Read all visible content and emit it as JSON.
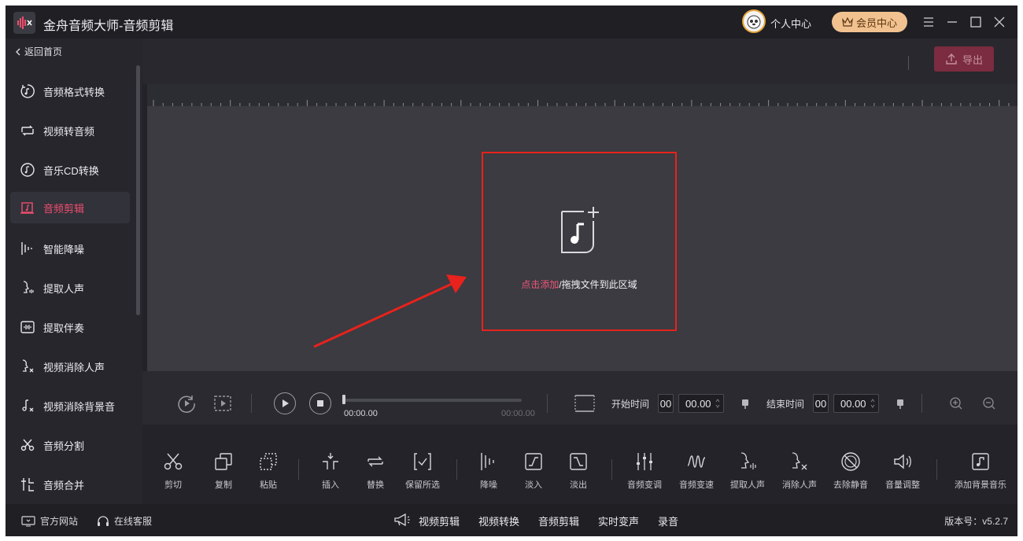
{
  "title_bar": {
    "app_title": "金舟音频大师-音频剪辑",
    "personal_center": "个人中心",
    "vip_center": "会员中心"
  },
  "sidebar": {
    "back_label": "返回首页",
    "items": [
      {
        "label": "音频格式转换",
        "icon": "audio-convert-icon"
      },
      {
        "label": "视频转音频",
        "icon": "video-to-audio-icon"
      },
      {
        "label": "音乐CD转换",
        "icon": "cd-icon"
      },
      {
        "label": "音频剪辑",
        "icon": "audio-edit-icon",
        "active": true
      },
      {
        "label": "智能降噪",
        "icon": "denoise-icon"
      },
      {
        "label": "提取人声",
        "icon": "extract-voice-icon"
      },
      {
        "label": "提取伴奏",
        "icon": "extract-accompaniment-icon"
      },
      {
        "label": "视频消除人声",
        "icon": "remove-voice-icon"
      },
      {
        "label": "视频消除背景音",
        "icon": "remove-bg-sound-icon"
      },
      {
        "label": "音频分割",
        "icon": "scissors-icon"
      },
      {
        "label": "音频合并",
        "icon": "merge-icon"
      }
    ]
  },
  "toolbar": {
    "export_label": "导出"
  },
  "dropzone": {
    "link_text": "点击添加",
    "rest_text": "/拖拽文件到此区域"
  },
  "player": {
    "current_time": "00:00.00",
    "total_time": "00:00.00",
    "start_label": "开始时间",
    "start_min": "00",
    "start_sec": "00.00",
    "end_label": "结束时间",
    "end_min": "00",
    "end_sec": "00.00"
  },
  "tools": [
    {
      "label": "剪切",
      "icon": "cut-icon"
    },
    {
      "label": "复制",
      "icon": "copy-icon"
    },
    {
      "label": "粘贴",
      "icon": "paste-icon"
    },
    {
      "label": "插入",
      "icon": "insert-icon"
    },
    {
      "label": "替换",
      "icon": "replace-icon"
    },
    {
      "label": "保留所选",
      "icon": "keep-selection-icon"
    },
    {
      "label": "降噪",
      "icon": "denoise-icon"
    },
    {
      "label": "淡入",
      "icon": "fade-in-icon"
    },
    {
      "label": "淡出",
      "icon": "fade-out-icon"
    },
    {
      "label": "音频变调",
      "icon": "pitch-icon"
    },
    {
      "label": "音频变速",
      "icon": "speed-icon"
    },
    {
      "label": "提取人声",
      "icon": "extract-voice-icon"
    },
    {
      "label": "消除人声",
      "icon": "remove-voice-icon"
    },
    {
      "label": "去除静音",
      "icon": "remove-silence-icon"
    },
    {
      "label": "音量调整",
      "icon": "volume-icon"
    },
    {
      "label": "添加背景音乐",
      "icon": "add-bgm-icon"
    }
  ],
  "footer": {
    "website": "官方网站",
    "service": "在线客服",
    "nav": [
      "视频剪辑",
      "视频转换",
      "音频剪辑",
      "实时变声",
      "录音"
    ],
    "version": "版本号：v5.2.7"
  },
  "colors": {
    "accent": "#ef4e6e",
    "export_bg": "#7b2c40",
    "vip_bg": "#f1c28f",
    "highlight_box": "#e8221c"
  }
}
